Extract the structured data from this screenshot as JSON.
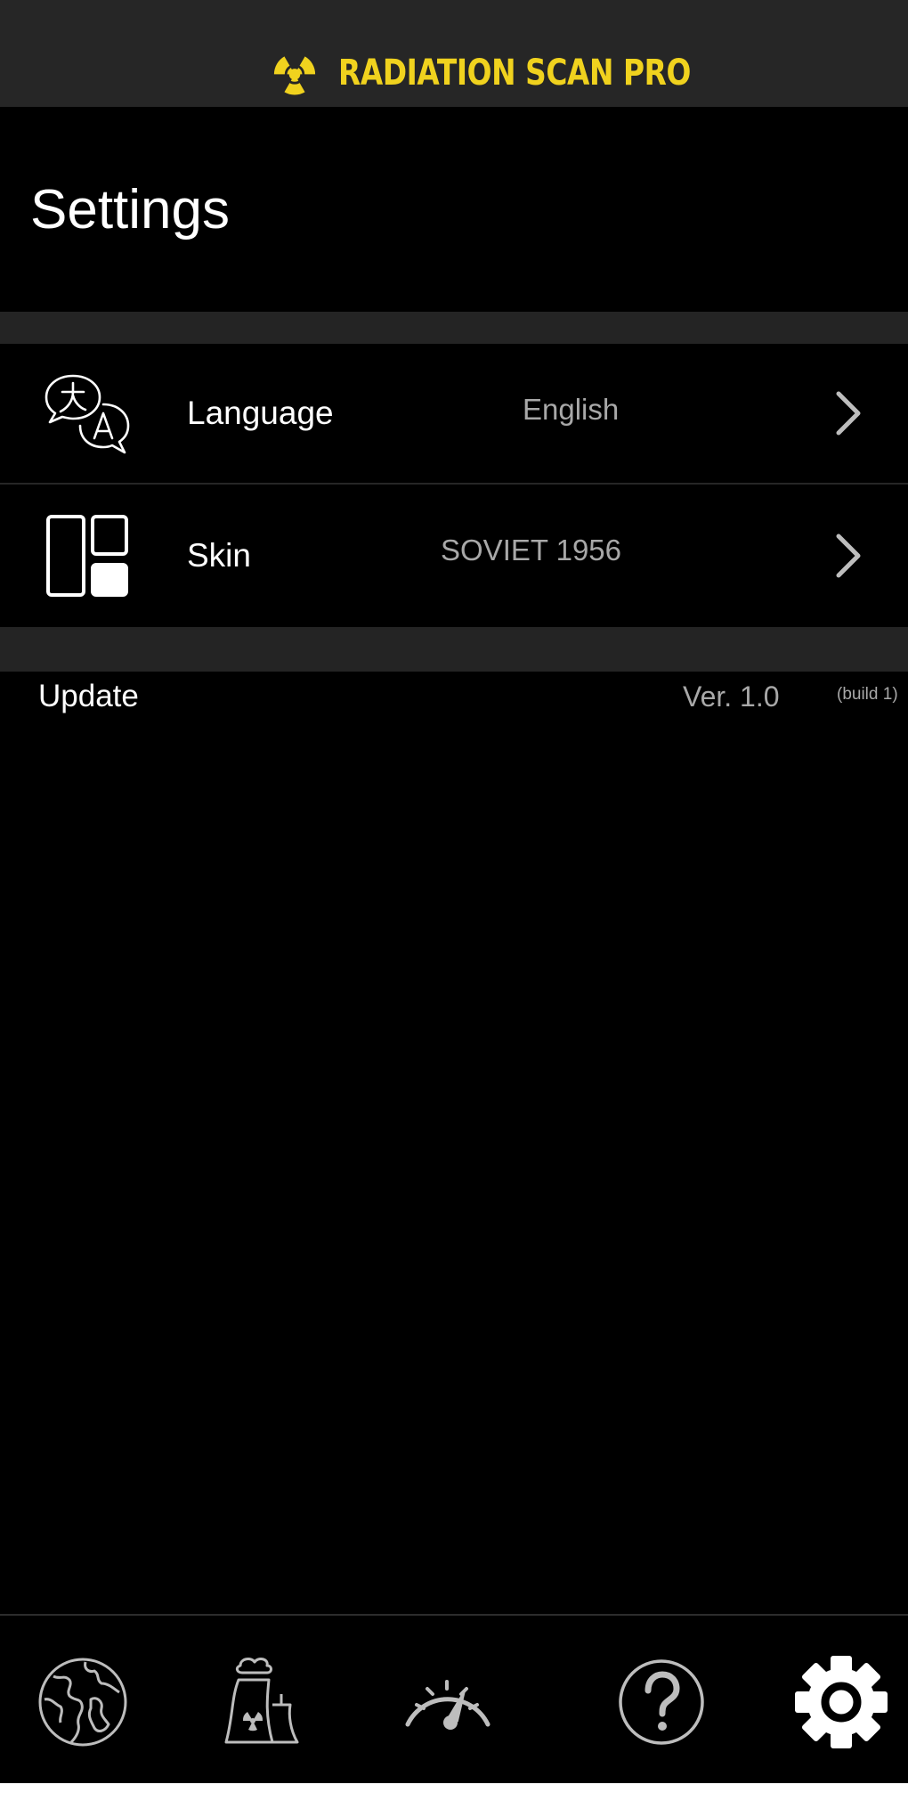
{
  "header": {
    "app_title": "RADIATION SCAN PRO",
    "brand_color": "#f0d21e",
    "logo_icon": "radiation-trefoil-icon"
  },
  "page": {
    "title": "Settings"
  },
  "settings": {
    "language": {
      "label": "Language",
      "value": "English",
      "icon": "translate-icon"
    },
    "skin": {
      "label": "Skin",
      "value": "SOVIET 1956",
      "icon": "layout-panels-icon"
    },
    "update": {
      "label": "Update",
      "version": "Ver. 1.0",
      "build": "(build 1)"
    }
  },
  "tabbar": {
    "items": [
      {
        "name": "map",
        "icon": "globe-icon"
      },
      {
        "name": "plants",
        "icon": "nuclear-plant-icon"
      },
      {
        "name": "meter",
        "icon": "gauge-icon"
      },
      {
        "name": "help",
        "icon": "question-circle-icon"
      },
      {
        "name": "settings",
        "icon": "gear-icon",
        "active": true
      }
    ]
  },
  "colors": {
    "background": "#000000",
    "header": "#262626",
    "separator": "#242424",
    "text_primary": "#ffffff",
    "text_secondary": "#a8a8a8",
    "tab_inactive": "#bdbdbd",
    "tab_active": "#ffffff"
  }
}
